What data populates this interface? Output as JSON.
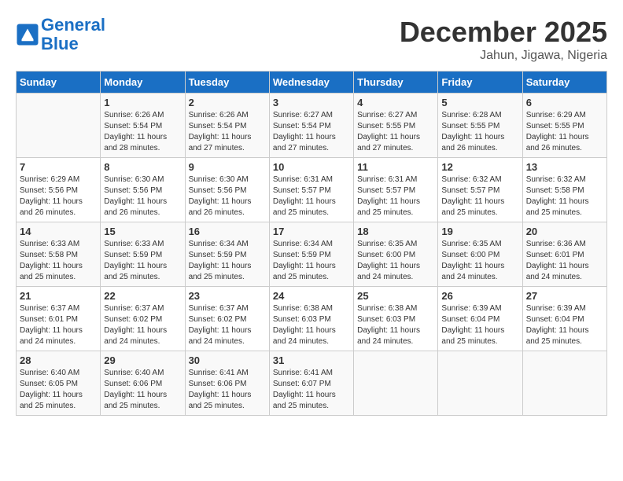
{
  "logo": {
    "line1": "General",
    "line2": "Blue"
  },
  "title": "December 2025",
  "location": "Jahun, Jigawa, Nigeria",
  "days_of_week": [
    "Sunday",
    "Monday",
    "Tuesday",
    "Wednesday",
    "Thursday",
    "Friday",
    "Saturday"
  ],
  "weeks": [
    [
      {
        "day": "",
        "sunrise": "",
        "sunset": "",
        "daylight": ""
      },
      {
        "day": "1",
        "sunrise": "Sunrise: 6:26 AM",
        "sunset": "Sunset: 5:54 PM",
        "daylight": "Daylight: 11 hours and 28 minutes."
      },
      {
        "day": "2",
        "sunrise": "Sunrise: 6:26 AM",
        "sunset": "Sunset: 5:54 PM",
        "daylight": "Daylight: 11 hours and 27 minutes."
      },
      {
        "day": "3",
        "sunrise": "Sunrise: 6:27 AM",
        "sunset": "Sunset: 5:54 PM",
        "daylight": "Daylight: 11 hours and 27 minutes."
      },
      {
        "day": "4",
        "sunrise": "Sunrise: 6:27 AM",
        "sunset": "Sunset: 5:55 PM",
        "daylight": "Daylight: 11 hours and 27 minutes."
      },
      {
        "day": "5",
        "sunrise": "Sunrise: 6:28 AM",
        "sunset": "Sunset: 5:55 PM",
        "daylight": "Daylight: 11 hours and 26 minutes."
      },
      {
        "day": "6",
        "sunrise": "Sunrise: 6:29 AM",
        "sunset": "Sunset: 5:55 PM",
        "daylight": "Daylight: 11 hours and 26 minutes."
      }
    ],
    [
      {
        "day": "7",
        "sunrise": "Sunrise: 6:29 AM",
        "sunset": "Sunset: 5:56 PM",
        "daylight": "Daylight: 11 hours and 26 minutes."
      },
      {
        "day": "8",
        "sunrise": "Sunrise: 6:30 AM",
        "sunset": "Sunset: 5:56 PM",
        "daylight": "Daylight: 11 hours and 26 minutes."
      },
      {
        "day": "9",
        "sunrise": "Sunrise: 6:30 AM",
        "sunset": "Sunset: 5:56 PM",
        "daylight": "Daylight: 11 hours and 26 minutes."
      },
      {
        "day": "10",
        "sunrise": "Sunrise: 6:31 AM",
        "sunset": "Sunset: 5:57 PM",
        "daylight": "Daylight: 11 hours and 25 minutes."
      },
      {
        "day": "11",
        "sunrise": "Sunrise: 6:31 AM",
        "sunset": "Sunset: 5:57 PM",
        "daylight": "Daylight: 11 hours and 25 minutes."
      },
      {
        "day": "12",
        "sunrise": "Sunrise: 6:32 AM",
        "sunset": "Sunset: 5:57 PM",
        "daylight": "Daylight: 11 hours and 25 minutes."
      },
      {
        "day": "13",
        "sunrise": "Sunrise: 6:32 AM",
        "sunset": "Sunset: 5:58 PM",
        "daylight": "Daylight: 11 hours and 25 minutes."
      }
    ],
    [
      {
        "day": "14",
        "sunrise": "Sunrise: 6:33 AM",
        "sunset": "Sunset: 5:58 PM",
        "daylight": "Daylight: 11 hours and 25 minutes."
      },
      {
        "day": "15",
        "sunrise": "Sunrise: 6:33 AM",
        "sunset": "Sunset: 5:59 PM",
        "daylight": "Daylight: 11 hours and 25 minutes."
      },
      {
        "day": "16",
        "sunrise": "Sunrise: 6:34 AM",
        "sunset": "Sunset: 5:59 PM",
        "daylight": "Daylight: 11 hours and 25 minutes."
      },
      {
        "day": "17",
        "sunrise": "Sunrise: 6:34 AM",
        "sunset": "Sunset: 5:59 PM",
        "daylight": "Daylight: 11 hours and 25 minutes."
      },
      {
        "day": "18",
        "sunrise": "Sunrise: 6:35 AM",
        "sunset": "Sunset: 6:00 PM",
        "daylight": "Daylight: 11 hours and 24 minutes."
      },
      {
        "day": "19",
        "sunrise": "Sunrise: 6:35 AM",
        "sunset": "Sunset: 6:00 PM",
        "daylight": "Daylight: 11 hours and 24 minutes."
      },
      {
        "day": "20",
        "sunrise": "Sunrise: 6:36 AM",
        "sunset": "Sunset: 6:01 PM",
        "daylight": "Daylight: 11 hours and 24 minutes."
      }
    ],
    [
      {
        "day": "21",
        "sunrise": "Sunrise: 6:37 AM",
        "sunset": "Sunset: 6:01 PM",
        "daylight": "Daylight: 11 hours and 24 minutes."
      },
      {
        "day": "22",
        "sunrise": "Sunrise: 6:37 AM",
        "sunset": "Sunset: 6:02 PM",
        "daylight": "Daylight: 11 hours and 24 minutes."
      },
      {
        "day": "23",
        "sunrise": "Sunrise: 6:37 AM",
        "sunset": "Sunset: 6:02 PM",
        "daylight": "Daylight: 11 hours and 24 minutes."
      },
      {
        "day": "24",
        "sunrise": "Sunrise: 6:38 AM",
        "sunset": "Sunset: 6:03 PM",
        "daylight": "Daylight: 11 hours and 24 minutes."
      },
      {
        "day": "25",
        "sunrise": "Sunrise: 6:38 AM",
        "sunset": "Sunset: 6:03 PM",
        "daylight": "Daylight: 11 hours and 24 minutes."
      },
      {
        "day": "26",
        "sunrise": "Sunrise: 6:39 AM",
        "sunset": "Sunset: 6:04 PM",
        "daylight": "Daylight: 11 hours and 25 minutes."
      },
      {
        "day": "27",
        "sunrise": "Sunrise: 6:39 AM",
        "sunset": "Sunset: 6:04 PM",
        "daylight": "Daylight: 11 hours and 25 minutes."
      }
    ],
    [
      {
        "day": "28",
        "sunrise": "Sunrise: 6:40 AM",
        "sunset": "Sunset: 6:05 PM",
        "daylight": "Daylight: 11 hours and 25 minutes."
      },
      {
        "day": "29",
        "sunrise": "Sunrise: 6:40 AM",
        "sunset": "Sunset: 6:06 PM",
        "daylight": "Daylight: 11 hours and 25 minutes."
      },
      {
        "day": "30",
        "sunrise": "Sunrise: 6:41 AM",
        "sunset": "Sunset: 6:06 PM",
        "daylight": "Daylight: 11 hours and 25 minutes."
      },
      {
        "day": "31",
        "sunrise": "Sunrise: 6:41 AM",
        "sunset": "Sunset: 6:07 PM",
        "daylight": "Daylight: 11 hours and 25 minutes."
      },
      {
        "day": "",
        "sunrise": "",
        "sunset": "",
        "daylight": ""
      },
      {
        "day": "",
        "sunrise": "",
        "sunset": "",
        "daylight": ""
      },
      {
        "day": "",
        "sunrise": "",
        "sunset": "",
        "daylight": ""
      }
    ]
  ]
}
